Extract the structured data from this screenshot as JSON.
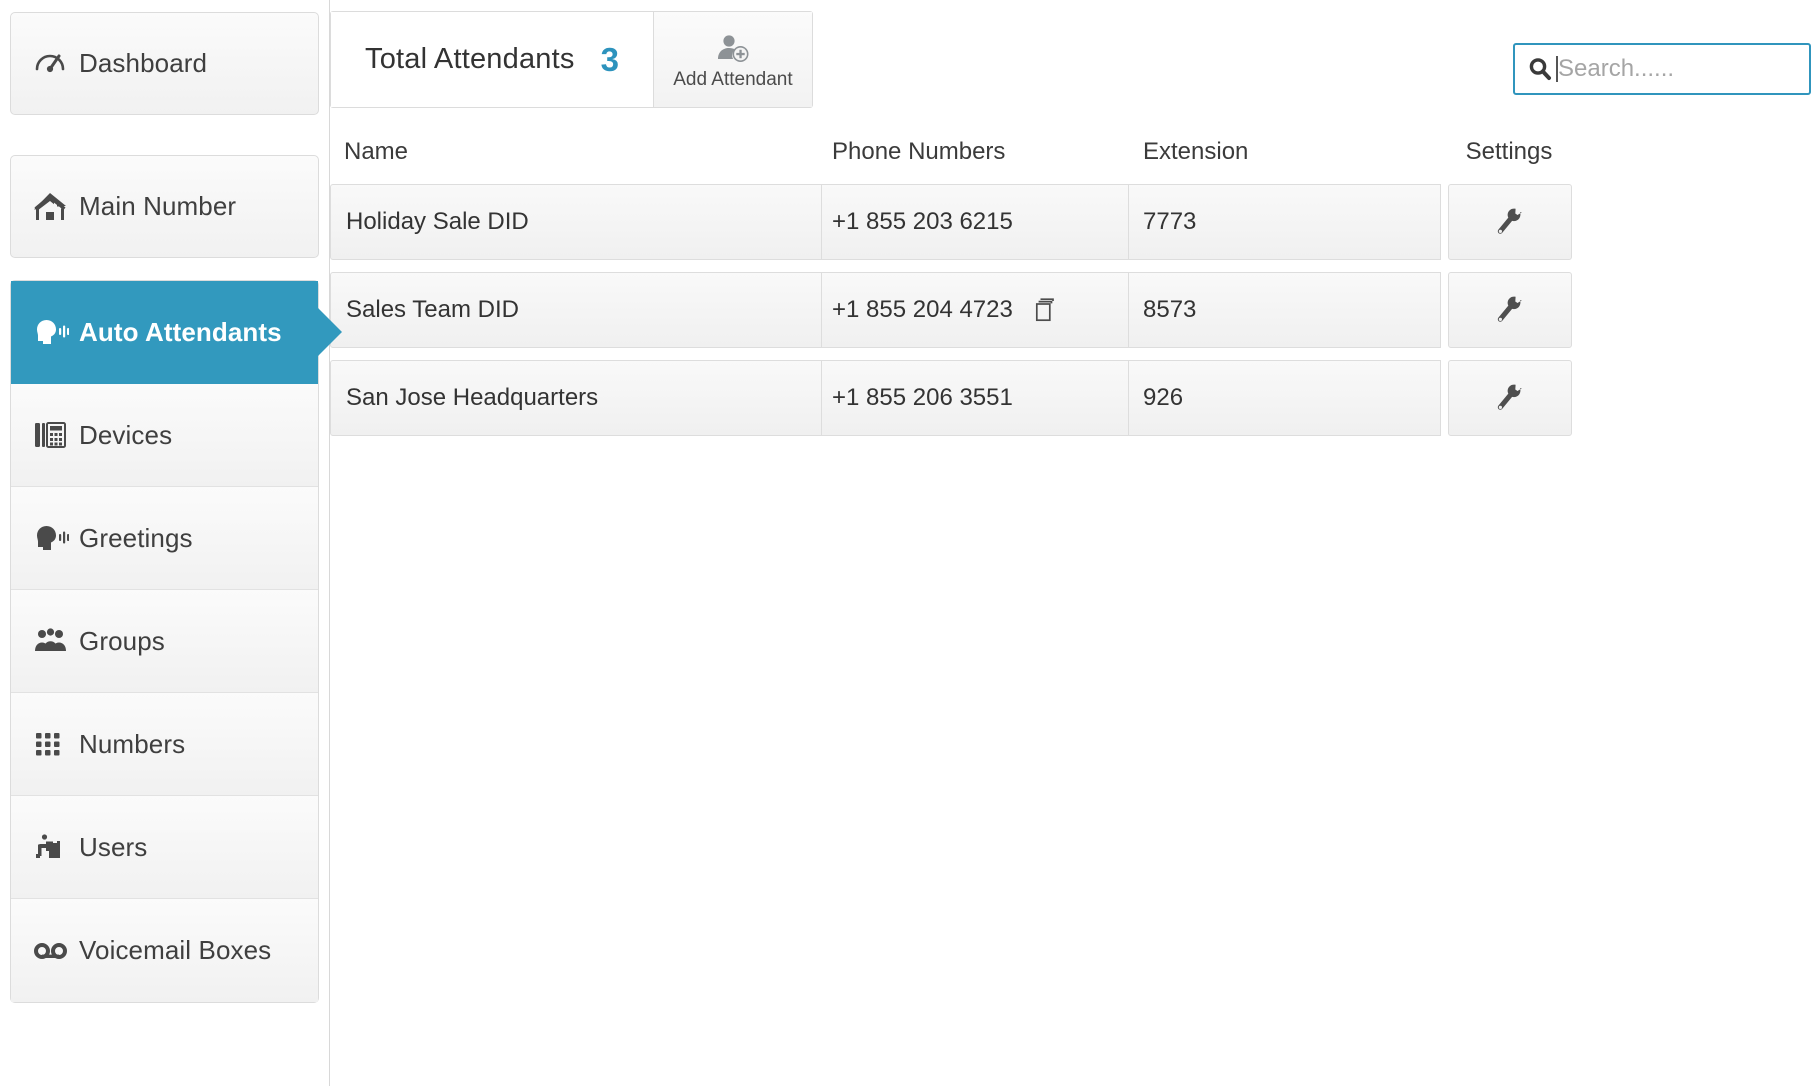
{
  "theme": {
    "accent": "#3299be",
    "count_color": "#2d93bd",
    "search_border": "#3095bd",
    "row_bg_top": "#f9f9f9",
    "row_bg_bottom": "#f0f0f0"
  },
  "sidebar": {
    "items": [
      {
        "label": "Dashboard",
        "icon": "dashboard-gauge-icon",
        "active": false
      },
      {
        "label": "Main Number",
        "icon": "home-icon",
        "active": false
      },
      {
        "label": "Auto Attendants",
        "icon": "speaking-head-icon",
        "active": true
      },
      {
        "label": "Devices",
        "icon": "desk-phone-icon",
        "active": false
      },
      {
        "label": "Greetings",
        "icon": "speaking-head-icon",
        "active": false
      },
      {
        "label": "Groups",
        "icon": "users-group-icon",
        "active": false
      },
      {
        "label": "Numbers",
        "icon": "dialpad-grid-icon",
        "active": false
      },
      {
        "label": "Users",
        "icon": "user-desk-icon",
        "active": false
      },
      {
        "label": "Voicemail Boxes",
        "icon": "voicemail-icon",
        "active": false
      }
    ]
  },
  "header": {
    "total_label": "Total Attendants",
    "total_count": "3",
    "add_button": {
      "label": "Add Attendant",
      "icon": "add-user-icon"
    }
  },
  "search": {
    "placeholder": "Search......",
    "value": "",
    "icon": "search-icon",
    "focused": true
  },
  "table": {
    "columns": [
      "Name",
      "Phone Numbers",
      "Extension",
      "Settings"
    ],
    "rows": [
      {
        "name": "Holiday Sale DID",
        "phone": "+1 855 203 6215",
        "extension": "7773",
        "has_copy_icon": false,
        "settings_icon": "wrench-icon"
      },
      {
        "name": "Sales Team DID",
        "phone": "+1 855 204 4723",
        "extension": "8573",
        "has_copy_icon": true,
        "copy_icon": "copy-icon",
        "settings_icon": "wrench-icon"
      },
      {
        "name": "San Jose Headquarters",
        "phone": "+1 855 206 3551",
        "extension": "926",
        "has_copy_icon": false,
        "settings_icon": "wrench-icon"
      }
    ]
  }
}
